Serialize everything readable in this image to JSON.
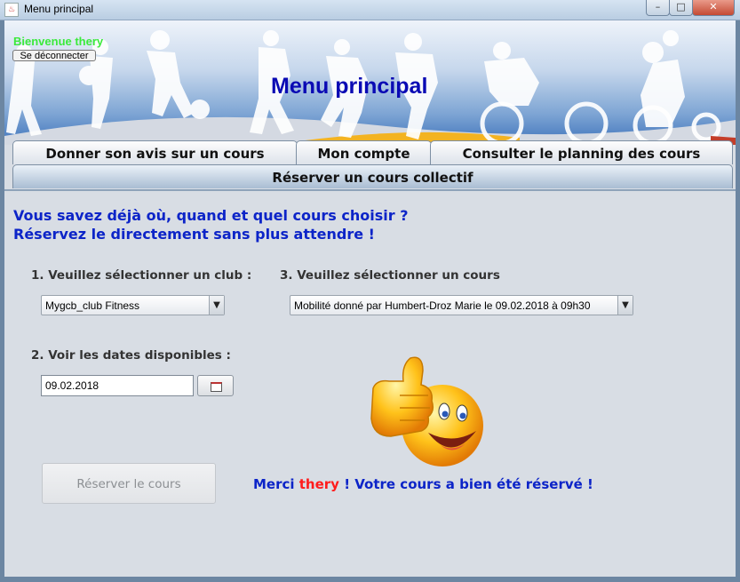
{
  "window": {
    "title": "Menu principal",
    "minimize": "–",
    "maximize": "□",
    "close": "✕",
    "app_icon": "java-icon"
  },
  "header": {
    "welcome": "Bienvenue thery",
    "logout_label": "Se déconnecter",
    "title": "Menu principal"
  },
  "tabs": [
    {
      "label": "Donner son avis sur un cours",
      "selected": false
    },
    {
      "label": "Mon compte",
      "selected": false
    },
    {
      "label": "Consulter le planning des cours",
      "selected": false
    },
    {
      "label": "Réserver un cours collectif",
      "selected": true
    }
  ],
  "content": {
    "intro_line1": "Vous savez déjà où, quand et quel cours choisir ?",
    "intro_line2": "Réservez le directement sans plus attendre !",
    "club_label": "1. Veuillez sélectionner un club :",
    "club_value": "Mygcb_club Fitness",
    "dates_label": "2. Voir les dates disponibles :",
    "date_value": "09.02.2018",
    "course_label": "3. Veuillez sélectionner un cours",
    "course_value": "Mobilité donné par Humbert-Droz Marie le 09.02.2018 à 09h30",
    "reserve_button": "Réserver le cours",
    "reserve_enabled": false,
    "confirm_prefix": "Merci ",
    "confirm_user": "thery",
    "confirm_suffix": " ! Votre cours a bien été réservé !"
  },
  "colors": {
    "welcome": "#3bea3b",
    "title": "#0a0ab4",
    "intro": "#0c24c8",
    "username": "#ff1c1c"
  },
  "icons": {
    "dropdown": "chevron-down-icon",
    "calendar": "calendar-icon",
    "thumbs_up": "thumbs-up-smiley-icon"
  }
}
